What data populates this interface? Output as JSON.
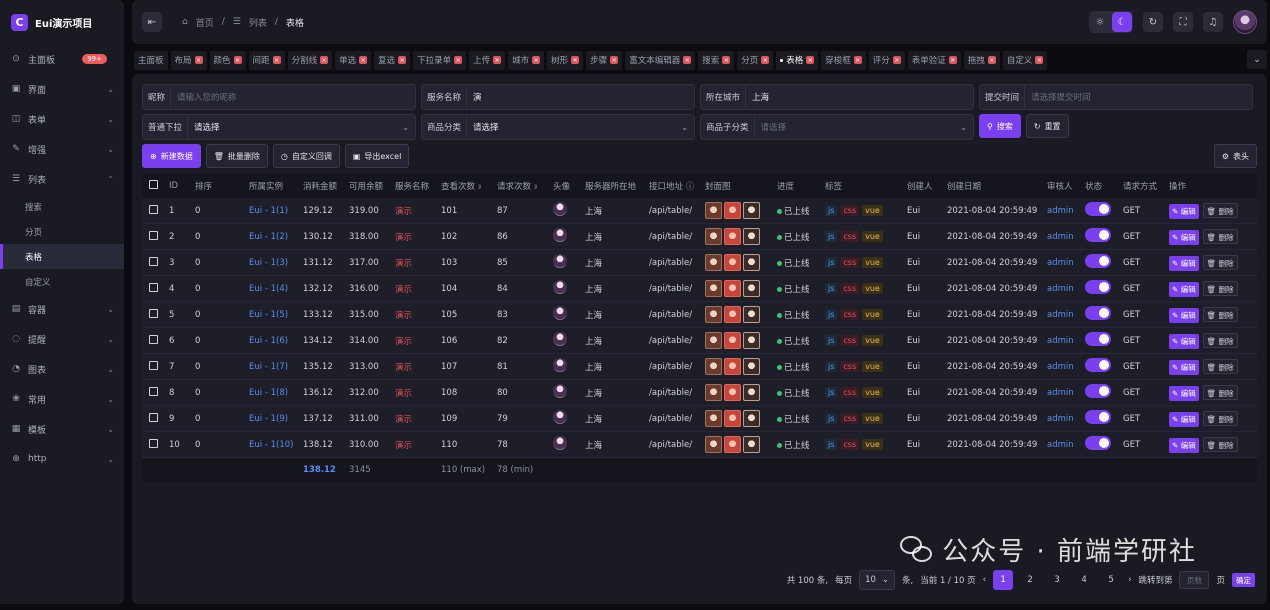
{
  "app": {
    "title": "Eui演示项目",
    "logo_letter": "C"
  },
  "sidebar": {
    "items": [
      {
        "icon": "dashboard-icon",
        "glyph": "⊙",
        "label": "主面板",
        "badge": "99+",
        "chev": ""
      },
      {
        "icon": "layout-icon",
        "glyph": "▣",
        "label": "界面",
        "chev": "⌄"
      },
      {
        "icon": "form-icon",
        "glyph": "◫",
        "label": "表单",
        "chev": "⌄"
      },
      {
        "icon": "enhance-icon",
        "glyph": "✎",
        "label": "增强",
        "chev": "⌄"
      },
      {
        "icon": "list-icon",
        "glyph": "☰",
        "label": "列表",
        "chev": "⌃"
      },
      {
        "icon": "container-icon",
        "glyph": "▤",
        "label": "容器",
        "chev": "⌄"
      },
      {
        "icon": "notice-icon",
        "glyph": "◌",
        "label": "提醒",
        "chev": "⌄"
      },
      {
        "icon": "chart-icon",
        "glyph": "◔",
        "label": "图表",
        "chev": "⌄"
      },
      {
        "icon": "common-icon",
        "glyph": "❀",
        "label": "常用",
        "chev": "⌄"
      },
      {
        "icon": "template-icon",
        "glyph": "▦",
        "label": "模板",
        "chev": "⌄"
      },
      {
        "icon": "http-icon",
        "glyph": "⊕",
        "label": "http",
        "chev": "⌄"
      }
    ],
    "sub_items": [
      "搜索",
      "分页",
      "表格",
      "自定义"
    ]
  },
  "header": {
    "breadcrumb": {
      "home": "首页",
      "sep": "/",
      "list": "列表",
      "current": "表格"
    }
  },
  "tabs": [
    {
      "label": "主面板",
      "closable": false
    },
    {
      "label": "布局",
      "closable": true
    },
    {
      "label": "颜色",
      "closable": true
    },
    {
      "label": "间距",
      "closable": true
    },
    {
      "label": "分割线",
      "closable": true
    },
    {
      "label": "单选",
      "closable": true
    },
    {
      "label": "复选",
      "closable": true
    },
    {
      "label": "下拉录单",
      "closable": true
    },
    {
      "label": "上传",
      "closable": true
    },
    {
      "label": "城市",
      "closable": true
    },
    {
      "label": "树形",
      "closable": true
    },
    {
      "label": "步骤",
      "closable": true
    },
    {
      "label": "富文本编辑器",
      "closable": true
    },
    {
      "label": "搜索",
      "closable": true
    },
    {
      "label": "分页",
      "closable": true
    },
    {
      "label": "表格",
      "closable": true,
      "active": true
    },
    {
      "label": "穿梭框",
      "closable": true
    },
    {
      "label": "评分",
      "closable": true
    },
    {
      "label": "表单验证",
      "closable": true
    },
    {
      "label": "拖拽",
      "closable": true
    },
    {
      "label": "自定义",
      "closable": true
    }
  ],
  "filters": {
    "nickname": {
      "label": "昵称",
      "placeholder": "请输入您的昵称"
    },
    "service_name": {
      "label": "服务名称",
      "value": "演"
    },
    "city": {
      "label": "所在城市",
      "value": "上海"
    },
    "submit_time": {
      "label": "提交时间",
      "placeholder": "请选择提交时间"
    },
    "normal_dropdown": {
      "label": "普通下拉",
      "value": "请选择"
    },
    "category": {
      "label": "商品分类",
      "value": "请选择"
    },
    "sub_category": {
      "label": "商品子分类",
      "placeholder": "请选择"
    },
    "search_btn": "搜索",
    "reset_btn": "重置"
  },
  "toolbar": {
    "add": "新建数据",
    "batch_delete": "批量删除",
    "custom_callback": "自定义回调",
    "export": "导出excel",
    "columns": "表头"
  },
  "table": {
    "headers": [
      "",
      "ID",
      "排序",
      "所属实例",
      "消耗金额",
      "可用余额",
      "服务名称",
      "查看次数",
      "请求次数",
      "头像",
      "服务器所在地",
      "接口地址",
      "封面图",
      "进度",
      "标签",
      "创建人",
      "创建日期",
      "审核人",
      "状态",
      "请求方式",
      "操作"
    ],
    "rows": [
      {
        "id": "1",
        "sort": "0",
        "instance": "Eui - 1(1)",
        "cost": "129.12",
        "balance": "319.00",
        "service": "演示",
        "views": "101",
        "requests": "87",
        "location": "上海",
        "api": "/api/table/",
        "progress": "已上线",
        "creator": "Eui",
        "date": "2021-08-04 20:59:49",
        "auditor": "admin",
        "method": "GET"
      },
      {
        "id": "2",
        "sort": "0",
        "instance": "Eui - 1(2)",
        "cost": "130.12",
        "balance": "318.00",
        "service": "演示",
        "views": "102",
        "requests": "86",
        "location": "上海",
        "api": "/api/table/",
        "progress": "已上线",
        "creator": "Eui",
        "date": "2021-08-04 20:59:49",
        "auditor": "admin",
        "method": "GET"
      },
      {
        "id": "3",
        "sort": "0",
        "instance": "Eui - 1(3)",
        "cost": "131.12",
        "balance": "317.00",
        "service": "演示",
        "views": "103",
        "requests": "85",
        "location": "上海",
        "api": "/api/table/",
        "progress": "已上线",
        "creator": "Eui",
        "date": "2021-08-04 20:59:49",
        "auditor": "admin",
        "method": "GET"
      },
      {
        "id": "4",
        "sort": "0",
        "instance": "Eui - 1(4)",
        "cost": "132.12",
        "balance": "316.00",
        "service": "演示",
        "views": "104",
        "requests": "84",
        "location": "上海",
        "api": "/api/table/",
        "progress": "已上线",
        "creator": "Eui",
        "date": "2021-08-04 20:59:49",
        "auditor": "admin",
        "method": "GET"
      },
      {
        "id": "5",
        "sort": "0",
        "instance": "Eui - 1(5)",
        "cost": "133.12",
        "balance": "315.00",
        "service": "演示",
        "views": "105",
        "requests": "83",
        "location": "上海",
        "api": "/api/table/",
        "progress": "已上线",
        "creator": "Eui",
        "date": "2021-08-04 20:59:49",
        "auditor": "admin",
        "method": "GET"
      },
      {
        "id": "6",
        "sort": "0",
        "instance": "Eui - 1(6)",
        "cost": "134.12",
        "balance": "314.00",
        "service": "演示",
        "views": "106",
        "requests": "82",
        "location": "上海",
        "api": "/api/table/",
        "progress": "已上线",
        "creator": "Eui",
        "date": "2021-08-04 20:59:49",
        "auditor": "admin",
        "method": "GET"
      },
      {
        "id": "7",
        "sort": "0",
        "instance": "Eui - 1(7)",
        "cost": "135.12",
        "balance": "313.00",
        "service": "演示",
        "views": "107",
        "requests": "81",
        "location": "上海",
        "api": "/api/table/",
        "progress": "已上线",
        "creator": "Eui",
        "date": "2021-08-04 20:59:49",
        "auditor": "admin",
        "method": "GET"
      },
      {
        "id": "8",
        "sort": "0",
        "instance": "Eui - 1(8)",
        "cost": "136.12",
        "balance": "312.00",
        "service": "演示",
        "views": "108",
        "requests": "80",
        "location": "上海",
        "api": "/api/table/",
        "progress": "已上线",
        "creator": "Eui",
        "date": "2021-08-04 20:59:49",
        "auditor": "admin",
        "method": "GET"
      },
      {
        "id": "9",
        "sort": "0",
        "instance": "Eui - 1(9)",
        "cost": "137.12",
        "balance": "311.00",
        "service": "演示",
        "views": "109",
        "requests": "79",
        "location": "上海",
        "api": "/api/table/",
        "progress": "已上线",
        "creator": "Eui",
        "date": "2021-08-04 20:59:49",
        "auditor": "admin",
        "method": "GET"
      },
      {
        "id": "10",
        "sort": "0",
        "instance": "Eui - 1(10)",
        "cost": "138.12",
        "balance": "310.00",
        "service": "演示",
        "views": "110",
        "requests": "78",
        "location": "上海",
        "api": "/api/table/",
        "progress": "已上线",
        "creator": "Eui",
        "date": "2021-08-04 20:59:49",
        "auditor": "admin",
        "method": "GET"
      }
    ],
    "tags": [
      "js",
      "css",
      "vue"
    ],
    "edit_label": "编辑",
    "delete_label": "删除",
    "footer": {
      "cost": "138.12",
      "balance": "3145",
      "views": "110 (max)",
      "requests": "78 (min)"
    }
  },
  "pagination": {
    "total": "共 100 条,",
    "per_page_label": "每页",
    "per_page": "10",
    "per_unit": "条,",
    "current": "当前 1 / 10 页",
    "pages": [
      "1",
      "2",
      "3",
      "4",
      "5"
    ],
    "jump_label": "跳转到第",
    "jump_placeholder": "页数",
    "page_unit": "页",
    "confirm": "确定"
  },
  "watermark": {
    "text": "公众号 · 前端学研社"
  },
  "colors": {
    "accent": "#7b3ff2",
    "link": "#5b8cf5",
    "online": "#3ec46d",
    "danger": "#e0525e"
  }
}
